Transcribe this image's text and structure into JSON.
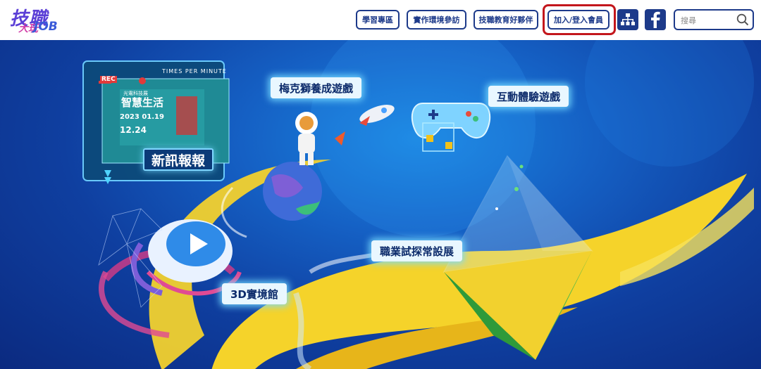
{
  "logo": {
    "line1": "技職",
    "line2": "大玩",
    "line3": "JOB"
  },
  "nav": {
    "learning": "學習專區",
    "virtual_tour": "實作環境參訪",
    "partners": "技職教育好夥伴",
    "login": "加入/登入會員"
  },
  "search": {
    "placeholder": "搜尋"
  },
  "hero": {
    "news_rec": "REC",
    "news_times": "TIMES PER MINUTE",
    "news_screen_title": "智慧生活",
    "news_screen_sub": "光電科技展",
    "news_date1": "2023 01.19",
    "news_date2": "12.24",
    "news_label": "新訊報報",
    "lion_game": "梅克獅養成遊戲",
    "interactive_game": "互動體驗遊戲",
    "career_exhibit": "職業試探常設展",
    "hall_3d": "3D實境館"
  },
  "colors": {
    "brand": "#1d3a8a",
    "highlight": "#c3161c",
    "hero_bg": "#1560c4"
  }
}
